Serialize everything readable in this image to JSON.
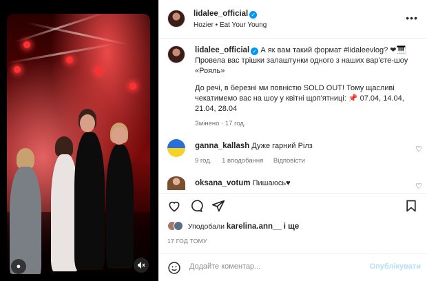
{
  "post": {
    "username": "lidalee_official",
    "audio": "Hozier • Eat Your Young",
    "more_label": "•••"
  },
  "caption": {
    "username": "lidalee_official",
    "line1": "А як вам такий формат #lidaleevlog? ❤🎹",
    "line2": "Провела вас трішки залаштунки одного з наших вар'єте-шоу",
    "line3": "«Рояль»",
    "line4": "До речі, в березні ми повністю SOLD OUT! Тому щасливі",
    "line5": "чекатимемо вас на шоу у квітні щоп'ятниці: 📌 07.04, 14.04,",
    "line6": "21.04, 28.04",
    "meta": "Змінено · 17 год."
  },
  "comments": [
    {
      "username": "ganna_kallash",
      "text": "Дуже гарний Рілз",
      "time": "9 год.",
      "likes": "1 вподобання",
      "reply": "Відповісти"
    },
    {
      "username": "oksana_votum",
      "text": "Пишаюсь♥"
    }
  ],
  "likes": {
    "prefix": "Уподобали",
    "user": "karelina.ann__",
    "suffix": "і ще"
  },
  "timestamp": "17 ГОД ТОМУ",
  "composer": {
    "placeholder": "Додайте коментар...",
    "post_label": "Опублікувати"
  },
  "colors": {
    "accent": "#0095f6",
    "post_disabled": "#b2dffc",
    "heart": "#ed2b2b"
  }
}
